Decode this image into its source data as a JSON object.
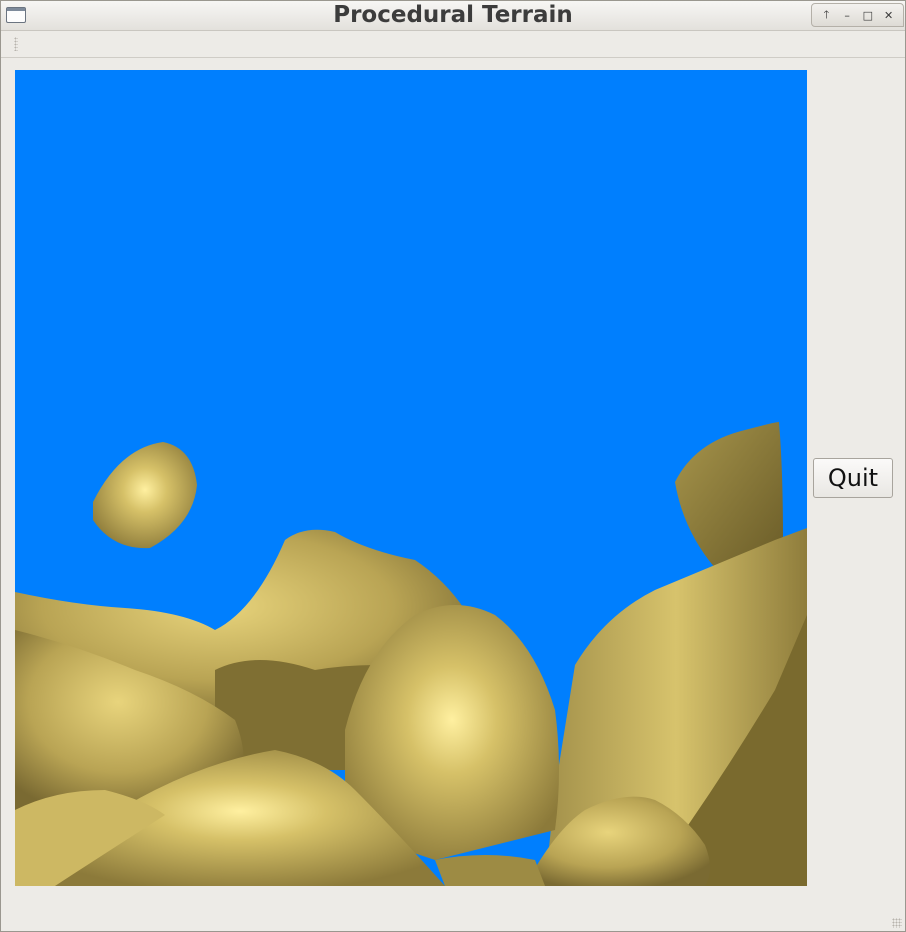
{
  "window": {
    "title": "Procedural Terrain",
    "buttons": {
      "shade": "🡑",
      "minimize": "–",
      "maximize": "□",
      "close": "✕"
    }
  },
  "viewport": {
    "sky_color": "#007ffe",
    "terrain_color": "#c8b35c"
  },
  "actions": {
    "quit_label": "Quit"
  }
}
